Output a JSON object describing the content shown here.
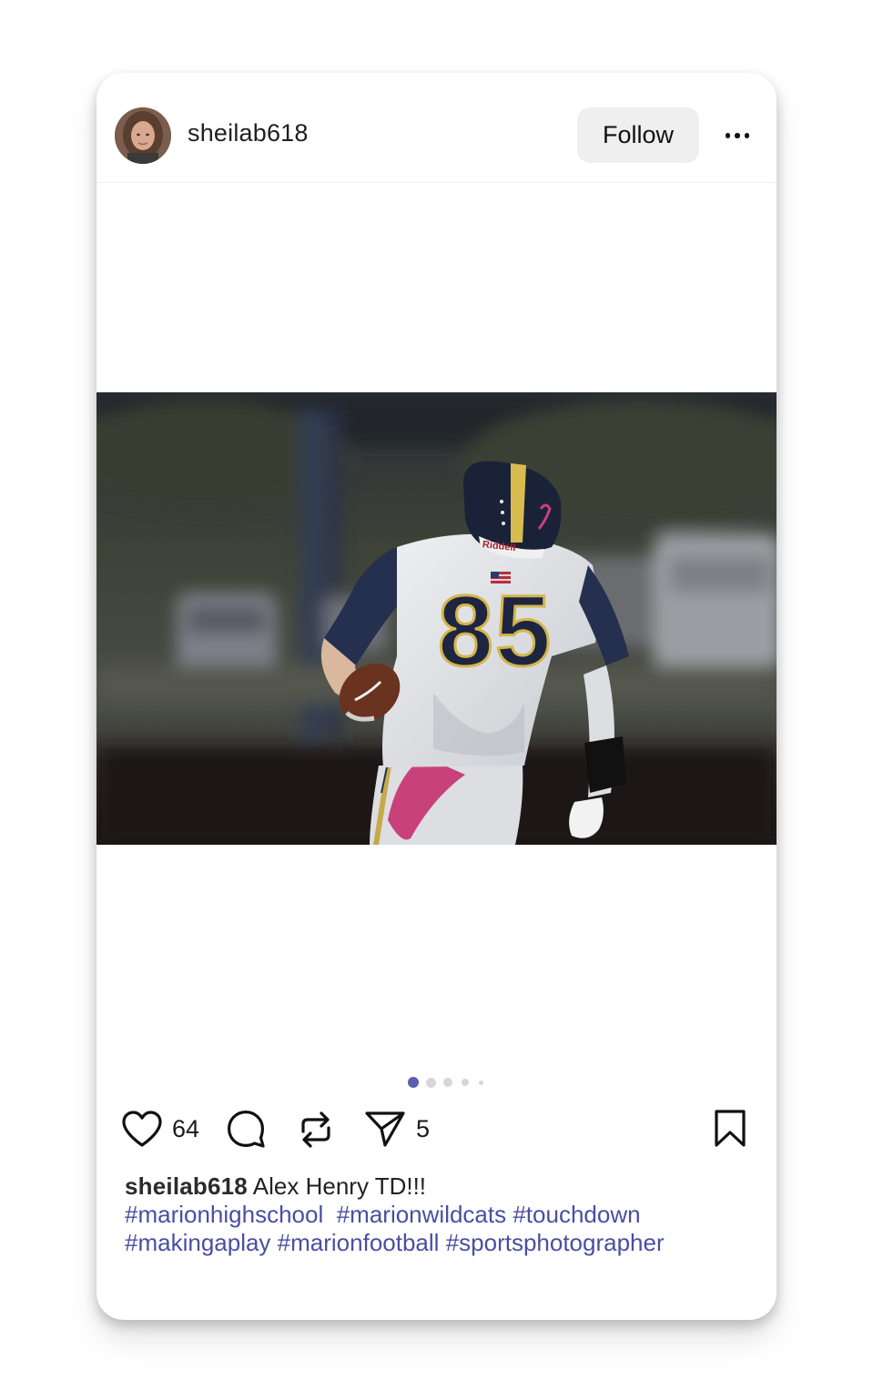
{
  "post": {
    "username": "sheilab618",
    "follow_label": "Follow",
    "image_alt": "Football player number 85 running with the ball",
    "jersey_number": "85",
    "helmet_text": "Riddell",
    "carousel": {
      "count": 5,
      "active_index": 0,
      "active_color": "#5a5fb0"
    },
    "actions": {
      "like_count": "64",
      "share_count": "5"
    },
    "caption": {
      "username": "sheilab618",
      "text": "Alex Henry TD!!!",
      "hashtags": [
        "#marionhighschool",
        "#marionwildcats",
        "#touchdown",
        "#makingaplay",
        "#marionfootball",
        "#sportsphotographer"
      ]
    },
    "colors": {
      "hashtag": "#4a4ea3",
      "follow_bg": "#efefef"
    },
    "icons": [
      "more-icon",
      "heart-icon",
      "comment-icon",
      "repost-icon",
      "share-icon",
      "bookmark-icon"
    ]
  }
}
